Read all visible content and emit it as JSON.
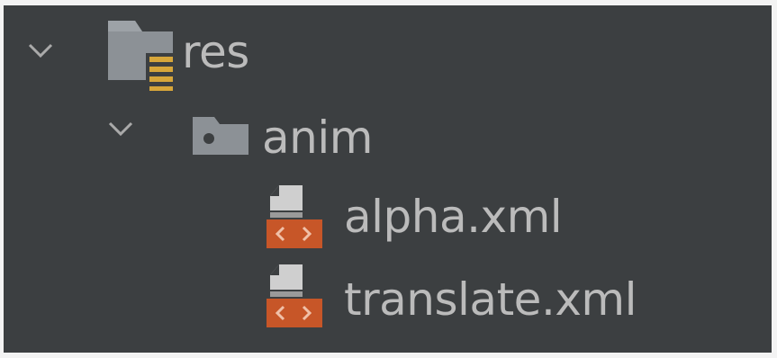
{
  "tree": {
    "items": [
      {
        "label": "res",
        "icon": "resource-folder-icon",
        "expanded": true
      },
      {
        "label": "anim",
        "icon": "folder-icon",
        "expanded": true
      },
      {
        "label": "alpha.xml",
        "icon": "xml-file-icon"
      },
      {
        "label": "translate.xml",
        "icon": "xml-file-icon"
      }
    ]
  },
  "colors": {
    "background": "#3c3f41",
    "text": "#bbbbbb",
    "folder": "#8c9196",
    "resource_lines": "#d7a63a",
    "xml_badge": "#c75628"
  }
}
